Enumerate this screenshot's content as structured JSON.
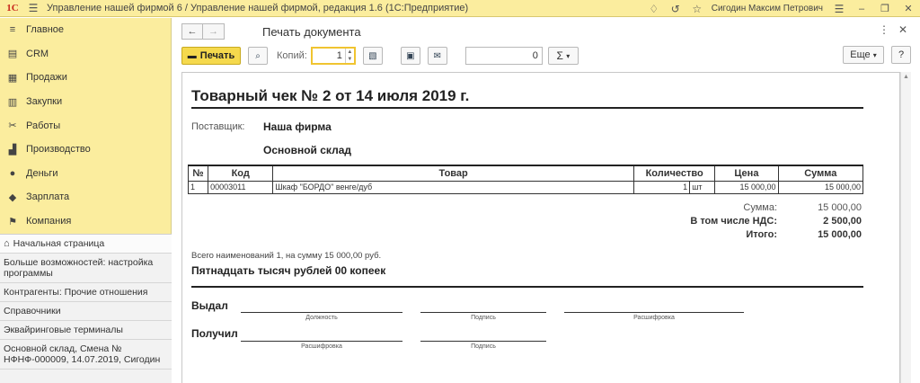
{
  "titlebar": {
    "logo": "1С",
    "title": "Управление нашей фирмой 6 / Управление нашей фирмой, редакция 1.6  (1С:Предприятие)",
    "user": "Сигодин Максим Петрович"
  },
  "sidebar": {
    "sections": [
      {
        "label": "Главное",
        "icon": "menu-icon"
      },
      {
        "label": "CRM",
        "icon": "crm-icon"
      },
      {
        "label": "Продажи",
        "icon": "sales-icon"
      },
      {
        "label": "Закупки",
        "icon": "purchases-icon"
      },
      {
        "label": "Работы",
        "icon": "tools-icon"
      },
      {
        "label": "Производство",
        "icon": "factory-icon"
      },
      {
        "label": "Деньги",
        "icon": "money-icon"
      },
      {
        "label": "Зарплата",
        "icon": "salary-icon"
      },
      {
        "label": "Компания",
        "icon": "flag-icon"
      }
    ],
    "open_windows": [
      "Начальная страница",
      "Больше возможностей: настройка программы",
      "Контрагенты: Прочие отношения",
      "Справочники",
      "Эквайринговые терминалы",
      "Основной склад, Смена № НФНФ-000009, 14.07.2019, Сигодин"
    ]
  },
  "main": {
    "doc_title": "Печать документа",
    "toolbar": {
      "print_label": "Печать",
      "copies_label": "Копий:",
      "copies_value": "1",
      "sum_value": "0",
      "sigma": "Σ",
      "more_label": "Еще",
      "help_label": "?"
    }
  },
  "receipt": {
    "title": "Товарный чек № 2 от 14 июля 2019 г.",
    "supplier_label": "Поставщик:",
    "supplier_name": "Наша фирма",
    "warehouse": "Основной склад",
    "columns": [
      "№",
      "Код",
      "Товар",
      "Количество",
      "",
      "Цена",
      "Сумма"
    ],
    "rows": [
      {
        "num": "1",
        "code": "00003011",
        "item": "Шкаф \"БОРДО\" венге/дуб",
        "qty": "1",
        "unit": "шт",
        "price": "15 000,00",
        "sum": "15 000,00"
      }
    ],
    "totals": {
      "sum_label": "Сумма:",
      "sum_value": "15 000,00",
      "vat_label": "В том числе НДС:",
      "vat_value": "2 500,00",
      "total_label": "Итого:",
      "total_value": "15 000,00"
    },
    "words_small": "Всего наименований 1, на сумму 15 000,00 руб.",
    "words_big": "Пятнадцать тысяч рублей 00 копеек",
    "issued_label": "Выдал",
    "received_label": "Получил",
    "cap_position": "Должность",
    "cap_signature": "Подпись",
    "cap_decode": "Расшифровка"
  }
}
